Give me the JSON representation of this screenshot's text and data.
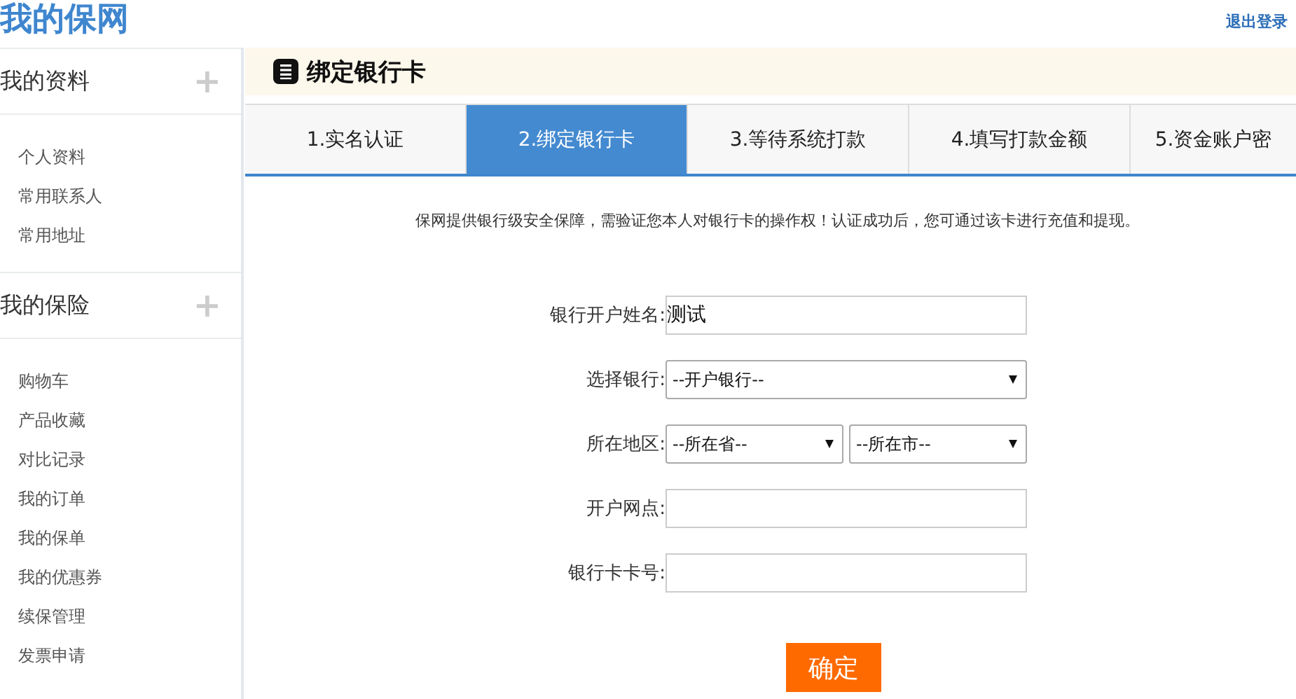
{
  "header": {
    "logo": "我的保网",
    "logout": "退出登录"
  },
  "sidebar": {
    "groups": [
      {
        "title": "我的资料",
        "expand_icon": "+",
        "items": [
          "个人资料",
          "常用联系人",
          "常用地址"
        ]
      },
      {
        "title": "我的保险",
        "expand_icon": "+",
        "items": [
          "购物车",
          "产品收藏",
          "对比记录",
          "我的订单",
          "我的保单",
          "我的优惠券",
          "续保管理",
          "发票申请"
        ]
      }
    ]
  },
  "page_title": "绑定银行卡",
  "tabs": [
    {
      "label": "1.实名认证",
      "selected": false
    },
    {
      "label": "2.绑定银行卡",
      "selected": true
    },
    {
      "label": "3.等待系统打款",
      "selected": false
    },
    {
      "label": "4.填写打款金额",
      "selected": false
    },
    {
      "label": "5.资金账户密",
      "selected": false
    }
  ],
  "notice": "保网提供银行级安全保障，需验证您本人对银行卡的操作权！认证成功后，您可通过该卡进行充值和提现。",
  "form": [
    {
      "kind": "text",
      "label": "银行开户姓名:",
      "value": "测试"
    },
    {
      "kind": "select",
      "label": "选择银行:",
      "options": [
        "--开户银行--"
      ]
    },
    {
      "kind": "select",
      "label": "所在地区:",
      "options": [
        "--所在省--",
        "--所在市--"
      ]
    },
    {
      "kind": "text",
      "label": "开户网点:"
    },
    {
      "kind": "text",
      "label": "银行卡卡号:"
    }
  ],
  "submit": "确定"
}
